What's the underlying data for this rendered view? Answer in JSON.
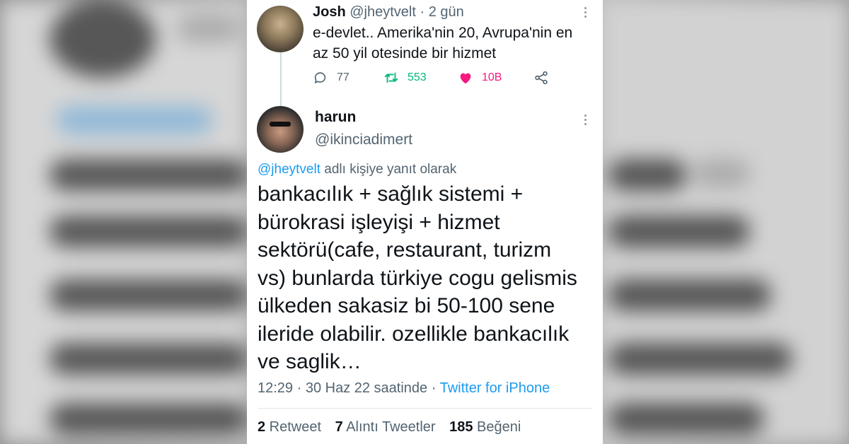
{
  "parent_tweet": {
    "name": "Josh",
    "handle": "@jheytvelt",
    "sep": "·",
    "time": "2 gün",
    "text_lines": [
      "e-devlet.. Amerika'nin 20, Avrupa'nin en",
      "az 50 yil otesinde bir hizmet"
    ],
    "replies": "77",
    "retweets": "553",
    "likes": "10B"
  },
  "main_tweet": {
    "name": "harun",
    "handle": "@ikinciadimert",
    "reply_mention": "@jheytvelt",
    "reply_suffix": " adlı kişiye yanıt olarak",
    "text_lines": [
      "bankacılık + sağlık sistemi +",
      "bürokrasi işleyişi + hizmet",
      "sektörü(cafe, restaurant, turizm",
      "vs) bunlarda türkiye cogu gelismis",
      "ülkeden sakasiz bi 50-100 sene",
      "ileride olabilir. ozellikle bankacılık",
      "ve saglik…"
    ],
    "timestamp": "12:29 · 30 Haz 22 saatinde · ",
    "source": "Twitter for iPhone",
    "retweet_count": "2",
    "retweet_label": " Retweet",
    "quote_count": "7",
    "quote_label": " Alıntı Tweetler",
    "like_count": "185",
    "like_label": " Beğeni"
  },
  "colors": {
    "accent": "#1d9bf0",
    "retweet": "#00ba7c",
    "like": "#f91880",
    "secondary_text": "#536471",
    "primary_text": "#0f1419"
  },
  "icons": [
    "reply-icon",
    "retweet-icon",
    "heart-icon",
    "share-icon",
    "more-icon"
  ]
}
